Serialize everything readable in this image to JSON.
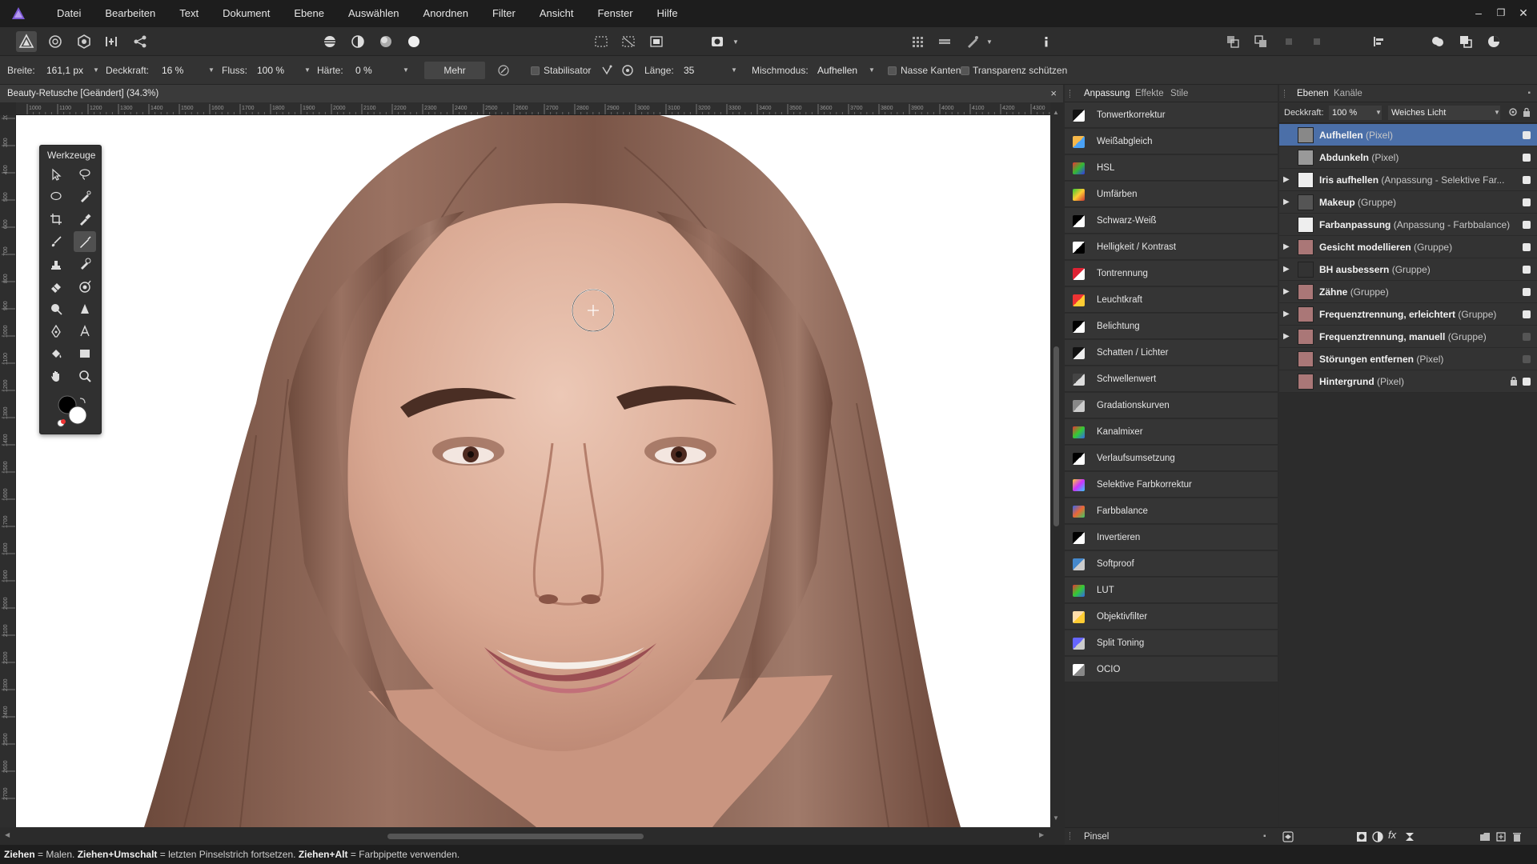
{
  "menu": {
    "items": [
      "Datei",
      "Bearbeiten",
      "Text",
      "Dokument",
      "Ebene",
      "Auswählen",
      "Anordnen",
      "Filter",
      "Ansicht",
      "Fenster",
      "Hilfe"
    ],
    "window_controls": [
      "–",
      "❐",
      "✕"
    ]
  },
  "context_toolbar": {
    "width_label": "Breite:",
    "width_value": "161,1 px",
    "opacity_label": "Deckkraft:",
    "opacity_value": "16 %",
    "flow_label": "Fluss:",
    "flow_value": "100 %",
    "hardness_label": "Härte:",
    "hardness_value": "0 %",
    "more_label": "Mehr",
    "stabilizer_label": "Stabilisator",
    "length_label": "Länge:",
    "length_value": "35",
    "blend_label": "Mischmodus:",
    "blend_value": "Aufhellen",
    "wet_edges_label": "Nasse Kanten",
    "protect_alpha_label": "Transparenz schützen"
  },
  "document": {
    "title": "Beauty-Retusche [Geändert] (34.3%)",
    "close": "×"
  },
  "ruler": {
    "h_labels": [
      "1000",
      "1100",
      "1200",
      "1300",
      "1400",
      "1500",
      "1600",
      "1700",
      "1800",
      "1900",
      "2000",
      "2100",
      "2200",
      "2300",
      "2400",
      "2500",
      "2600",
      "2700",
      "2800",
      "2900",
      "3000",
      "3100",
      "3200",
      "3300",
      "3400",
      "3500",
      "3600",
      "3700",
      "3800",
      "3900",
      "4000",
      "4100",
      "4200",
      "4300",
      "4400"
    ],
    "v_labels": [
      "200",
      "300",
      "400",
      "500",
      "600",
      "700",
      "800",
      "900",
      "1000",
      "1100",
      "1200",
      "1300",
      "1400",
      "1500",
      "1600",
      "1700",
      "1800",
      "1900",
      "2000",
      "2100",
      "2200",
      "2300",
      "2400",
      "2500",
      "2600",
      "2700"
    ]
  },
  "tools_panel": {
    "title": "Werkzeuge"
  },
  "adjust_panel": {
    "tabs": [
      "Anpassung",
      "Effekte",
      "Stile"
    ],
    "items": [
      {
        "label": "Tonwertkorrektur",
        "icon": "levels-icon"
      },
      {
        "label": "Weißabgleich",
        "icon": "white-balance-icon"
      },
      {
        "label": "HSL",
        "icon": "hsl-icon"
      },
      {
        "label": "Umfärben",
        "icon": "recolor-icon"
      },
      {
        "label": "Schwarz-Weiß",
        "icon": "black-white-icon"
      },
      {
        "label": "Helligkeit / Kontrast",
        "icon": "brightness-contrast-icon"
      },
      {
        "label": "Tontrennung",
        "icon": "posterize-icon"
      },
      {
        "label": "Leuchtkraft",
        "icon": "vibrance-icon"
      },
      {
        "label": "Belichtung",
        "icon": "exposure-icon"
      },
      {
        "label": "Schatten / Lichter",
        "icon": "shadows-highlights-icon"
      },
      {
        "label": "Schwellenwert",
        "icon": "threshold-icon"
      },
      {
        "label": "Gradationskurven",
        "icon": "curves-icon"
      },
      {
        "label": "Kanalmixer",
        "icon": "channel-mixer-icon"
      },
      {
        "label": "Verlaufsumsetzung",
        "icon": "gradient-map-icon"
      },
      {
        "label": "Selektive Farbkorrektur",
        "icon": "selective-color-icon"
      },
      {
        "label": "Farbbalance",
        "icon": "color-balance-icon"
      },
      {
        "label": "Invertieren",
        "icon": "invert-icon"
      },
      {
        "label": "Softproof",
        "icon": "soft-proof-icon"
      },
      {
        "label": "LUT",
        "icon": "lut-icon"
      },
      {
        "label": "Objektivfilter",
        "icon": "lens-filter-icon"
      },
      {
        "label": "Split Toning",
        "icon": "split-toning-icon"
      },
      {
        "label": "OCIO",
        "icon": "ocio-icon"
      }
    ],
    "bottom_label": "Pinsel"
  },
  "layers_panel": {
    "tabs": [
      "Ebenen",
      "Kanäle"
    ],
    "opacity_label": "Deckkraft:",
    "opacity_value": "100 %",
    "blend_value": "Weiches Licht",
    "layers": [
      {
        "name": "Aufhellen",
        "type": "(Pixel)",
        "expand": "",
        "selected": true,
        "visible": true,
        "locked": false
      },
      {
        "name": "Abdunkeln",
        "type": "(Pixel)",
        "expand": "",
        "selected": false,
        "visible": true,
        "locked": false
      },
      {
        "name": "Iris aufhellen",
        "type": "(Anpassung - Selektive Far...",
        "expand": "▶",
        "selected": false,
        "visible": true,
        "locked": false
      },
      {
        "name": "Makeup",
        "type": "(Gruppe)",
        "expand": "▶",
        "selected": false,
        "visible": true,
        "locked": false
      },
      {
        "name": "Farbanpassung",
        "type": "(Anpassung - Farbbalance)",
        "expand": "",
        "selected": false,
        "visible": true,
        "locked": false
      },
      {
        "name": "Gesicht modellieren",
        "type": "(Gruppe)",
        "expand": "▶",
        "selected": false,
        "visible": true,
        "locked": false
      },
      {
        "name": "BH ausbessern",
        "type": "(Gruppe)",
        "expand": "▶",
        "selected": false,
        "visible": true,
        "locked": false
      },
      {
        "name": "Zähne",
        "type": "(Gruppe)",
        "expand": "▶",
        "selected": false,
        "visible": true,
        "locked": false
      },
      {
        "name": "Frequenztrennung, erleichtert",
        "type": "(Gruppe)",
        "expand": "▶",
        "selected": false,
        "visible": true,
        "locked": false
      },
      {
        "name": "Frequenztrennung, manuell",
        "type": "(Gruppe)",
        "expand": "▶",
        "selected": false,
        "visible": false,
        "locked": false
      },
      {
        "name": "Störungen entfernen",
        "type": "(Pixel)",
        "expand": "",
        "selected": false,
        "visible": false,
        "locked": false
      },
      {
        "name": "Hintergrund",
        "type": "(Pixel)",
        "expand": "",
        "selected": false,
        "visible": true,
        "locked": true
      }
    ]
  },
  "status": {
    "k1": "Ziehen",
    "t1": " = Malen. ",
    "k2": "Ziehen+Umschalt",
    "t2": " = letzten Pinselstrich fortsetzen. ",
    "k3": "Ziehen+Alt",
    "t3": " = Farbpipette verwenden."
  },
  "colors": {
    "selection": "#4b6fa8",
    "panel": "#2c2c2c",
    "menubar": "#1d1d1d",
    "accent_logo": "#7d5ad6"
  }
}
